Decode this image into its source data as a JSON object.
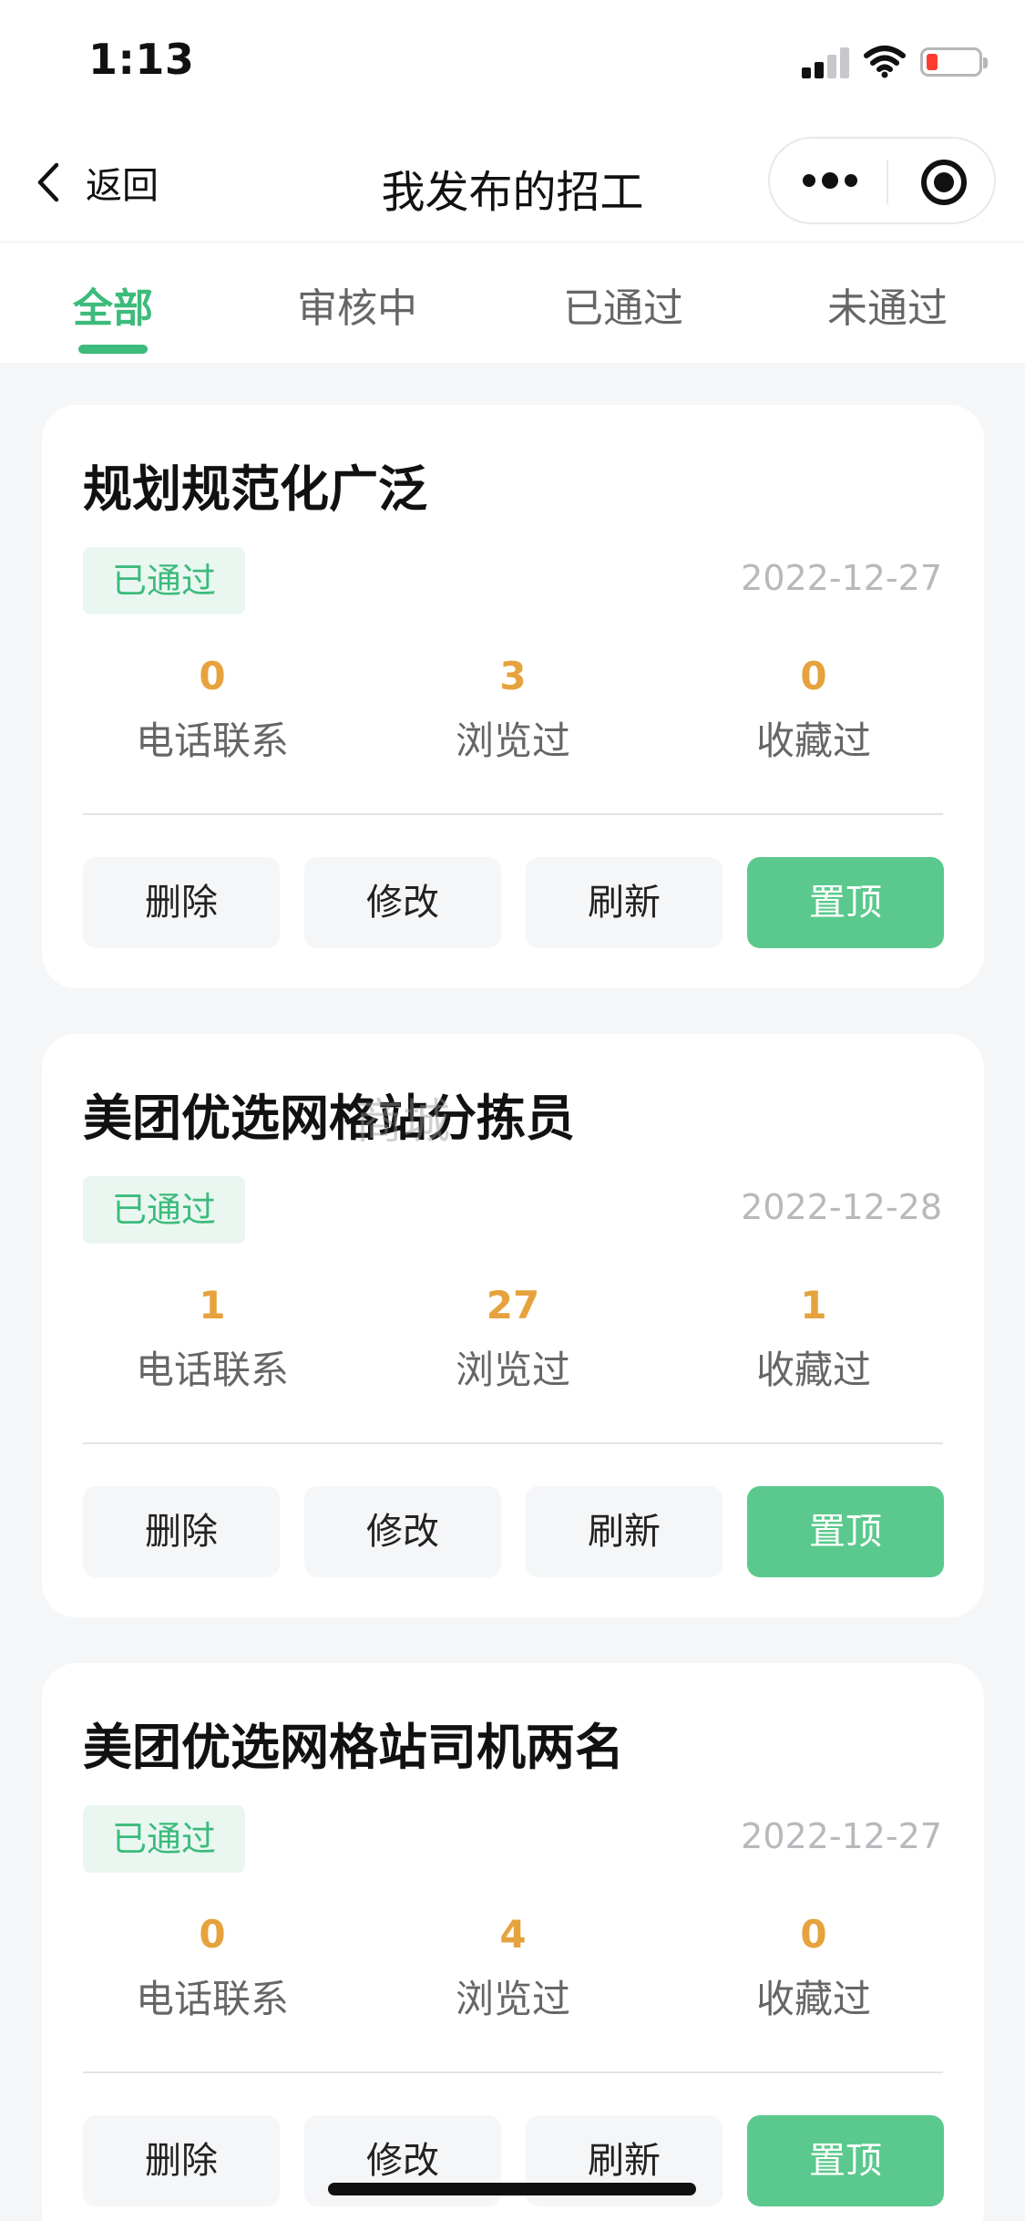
{
  "status_bar": {
    "time": "1:13"
  },
  "navbar": {
    "back_label": "返回",
    "title": "我发布的招工"
  },
  "tabs": [
    {
      "label": "全部",
      "active": true
    },
    {
      "label": "审核中",
      "active": false
    },
    {
      "label": "已通过",
      "active": false
    },
    {
      "label": "未通过",
      "active": false
    }
  ],
  "jobs": [
    {
      "title": "规划规范化广泛",
      "status": "已通过",
      "date": "2022-12-27",
      "stats": [
        {
          "value": "0",
          "label": "电话联系"
        },
        {
          "value": "3",
          "label": "浏览过"
        },
        {
          "value": "0",
          "label": "收藏过"
        }
      ],
      "actions": [
        "删除",
        "修改",
        "刷新",
        "置顶"
      ]
    },
    {
      "title": "美团优选网格站分拣员",
      "status": "已通过",
      "date": "2022-12-28",
      "stats": [
        {
          "value": "1",
          "label": "电话联系"
        },
        {
          "value": "27",
          "label": "浏览过"
        },
        {
          "value": "1",
          "label": "收藏过"
        }
      ],
      "actions": [
        "删除",
        "修改",
        "刷新",
        "置顶"
      ]
    },
    {
      "title": "美团优选网格站司机两名",
      "status": "已通过",
      "date": "2022-12-27",
      "stats": [
        {
          "value": "0",
          "label": "电话联系"
        },
        {
          "value": "4",
          "label": "浏览过"
        },
        {
          "value": "0",
          "label": "收藏过"
        }
      ],
      "actions": [
        "删除",
        "修改",
        "刷新",
        "置顶"
      ]
    }
  ],
  "watermark": "商城",
  "colors": {
    "accent": "#3dbb7c",
    "accent_button": "#5bc98d",
    "stat_value": "#e6a23c",
    "badge_bg": "#eaf7f1",
    "page_bg": "#f5f6f8"
  },
  "icons": {
    "back": "chevron-left-icon",
    "more": "more-dots-icon",
    "close": "target-circle-icon",
    "signal": "signal-icon",
    "wifi": "wifi-icon",
    "battery": "battery-icon"
  }
}
